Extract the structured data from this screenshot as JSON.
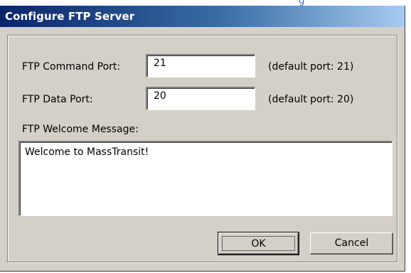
{
  "background": {
    "fragment_text": "g"
  },
  "dialog": {
    "title": "Configure FTP Server",
    "command_port": {
      "label": "FTP Command Port:",
      "value": "21",
      "hint": "(default port: 21)"
    },
    "data_port": {
      "label": "FTP Data Port:",
      "value": "20",
      "hint": "(default port: 20)"
    },
    "welcome": {
      "label": "FTP Welcome Message:",
      "value": "Welcome to MassTransit!"
    },
    "buttons": {
      "ok_label": "OK",
      "cancel_label": "Cancel"
    }
  },
  "colors": {
    "titlebar_start": "#0a246a",
    "titlebar_end": "#a6caf0",
    "dialog_face": "#d4d0c8"
  }
}
